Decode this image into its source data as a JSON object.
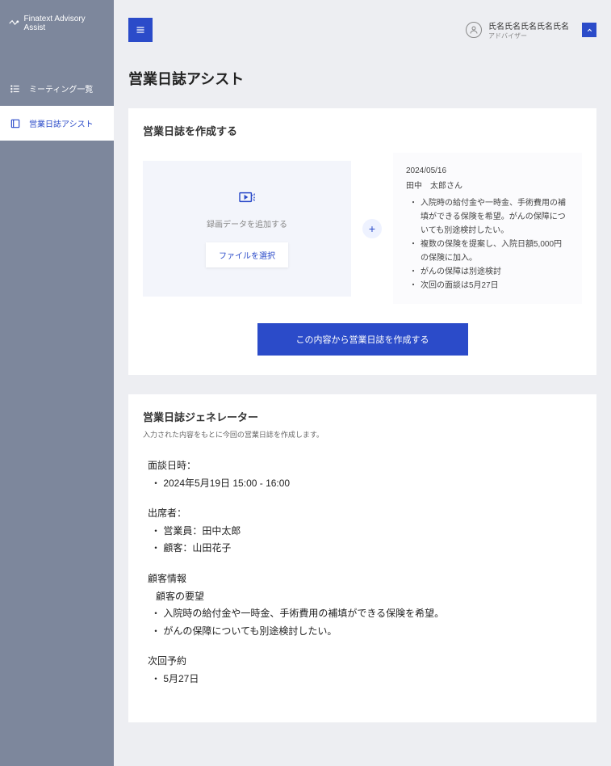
{
  "brand": "Finatext Advisory Assist",
  "nav": {
    "meetings": "ミーティング一覧",
    "assist": "営業日誌アシスト"
  },
  "user": {
    "name": "氏名氏名氏名氏名氏名",
    "role": "アドバイザー"
  },
  "page_title": "営業日誌アシスト",
  "create": {
    "title": "営業日誌を作成する",
    "upload_text": "録画データを追加する",
    "file_button": "ファイルを選択",
    "plus": "+",
    "info": {
      "date": "2024/05/16",
      "name": "田中　太郎さん",
      "bullets": [
        "入院時の給付金や一時金、手術費用の補填ができる保険を希望。がんの保障についても別途検討したい。",
        "複数の保険を提案し、入院日額5,000円の保険に加入。",
        "がんの保障は別途検討",
        "次回の面談は5月27日"
      ]
    },
    "submit": "この内容から営業日誌を作成する"
  },
  "generator": {
    "title": "営業日誌ジェネレーター",
    "subtitle": "入力された内容をもとに今回の営業日誌を作成します。",
    "s1_label": "面談日時：",
    "s1_v1": "・ 2024年5月19日 15:00 - 16:00",
    "s2_label": "出席者：",
    "s2_v1": "・ 営業員：田中太郎",
    "s2_v2": "・ 顧客：山田花子",
    "s3_label": "顧客情報",
    "s3_sub": "顧客の要望",
    "s3_v1": "・ 入院時の給付金や一時金、手術費用の補填ができる保険を希望。",
    "s3_v2": "・ がんの保障についても別途検討したい。",
    "s4_label": "次回予約",
    "s4_v1": "・ 5月27日"
  }
}
